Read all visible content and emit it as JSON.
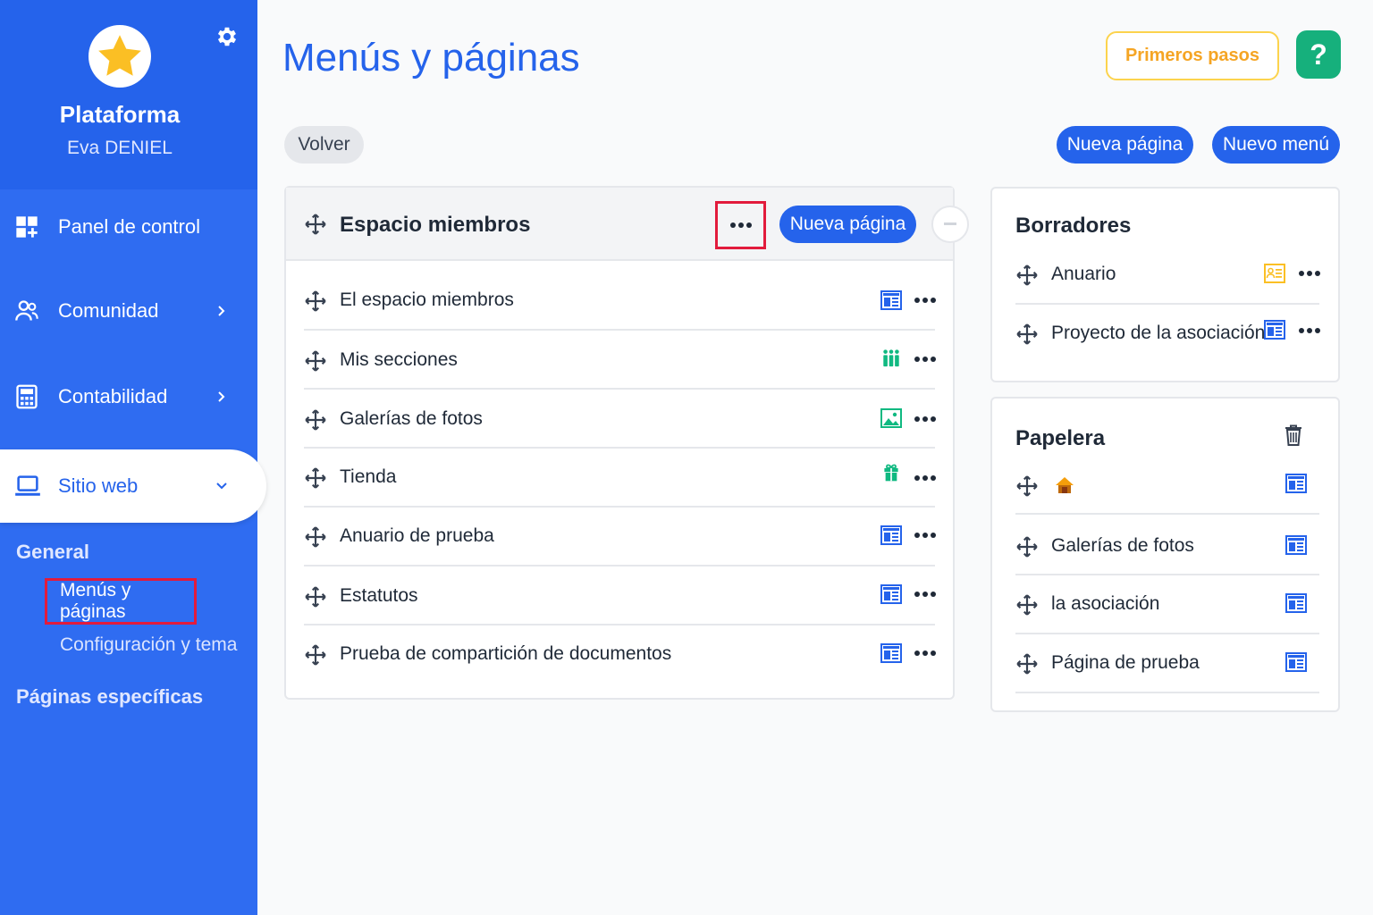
{
  "sidebar": {
    "org_name": "Plataforma",
    "user_name": "Eva DENIEL",
    "nav": [
      {
        "label": "Panel de control",
        "icon": "dashboard-icon"
      },
      {
        "label": "Comunidad",
        "icon": "users-icon"
      },
      {
        "label": "Contabilidad",
        "icon": "calculator-icon"
      },
      {
        "label": "Sitio web",
        "icon": "laptop-icon"
      }
    ],
    "section_general": "General",
    "link_menus": "Menús y páginas",
    "link_config": "Configuración y tema",
    "section_specific": "Páginas específicas"
  },
  "header": {
    "title": "Menús y páginas",
    "getting_started": "Primeros pasos",
    "help": "?"
  },
  "actions": {
    "back": "Volver",
    "new_page": "Nueva página",
    "new_menu": "Nuevo menú"
  },
  "menu": {
    "title": "Espacio miembros",
    "new_page": "Nueva página",
    "items": [
      {
        "label": "El espacio miembros",
        "icon": "page-layout-icon"
      },
      {
        "label": "Mis secciones",
        "icon": "people-group-icon"
      },
      {
        "label": "Galerías de fotos",
        "icon": "image-icon"
      },
      {
        "label": "Tienda",
        "icon": "gift-icon"
      },
      {
        "label": "Anuario de prueba",
        "icon": "page-layout-icon"
      },
      {
        "label": "Estatutos",
        "icon": "page-layout-icon"
      },
      {
        "label": "Prueba de compartición de documentos",
        "icon": "page-layout-icon"
      }
    ]
  },
  "drafts": {
    "title": "Borradores",
    "items": [
      {
        "label": "Anuario",
        "icon": "directory-card-icon"
      },
      {
        "label": "Proyecto de la asociación",
        "icon": "page-layout-icon"
      }
    ]
  },
  "trash": {
    "title": "Papelera",
    "items": [
      {
        "label": "",
        "icon": "home-icon"
      },
      {
        "label": "Galerías de fotos",
        "icon": "page-layout-icon"
      },
      {
        "label": "la asociación",
        "icon": "page-layout-icon"
      },
      {
        "label": "Página de prueba",
        "icon": "page-layout-icon"
      }
    ]
  },
  "colors": {
    "brand": "#2563eb",
    "sidebar": "#2f6cf1",
    "help_green": "#16b07c",
    "accent_yellow": "#f5a524",
    "highlight_red": "#e21b3c",
    "icon_green": "#10b981"
  }
}
